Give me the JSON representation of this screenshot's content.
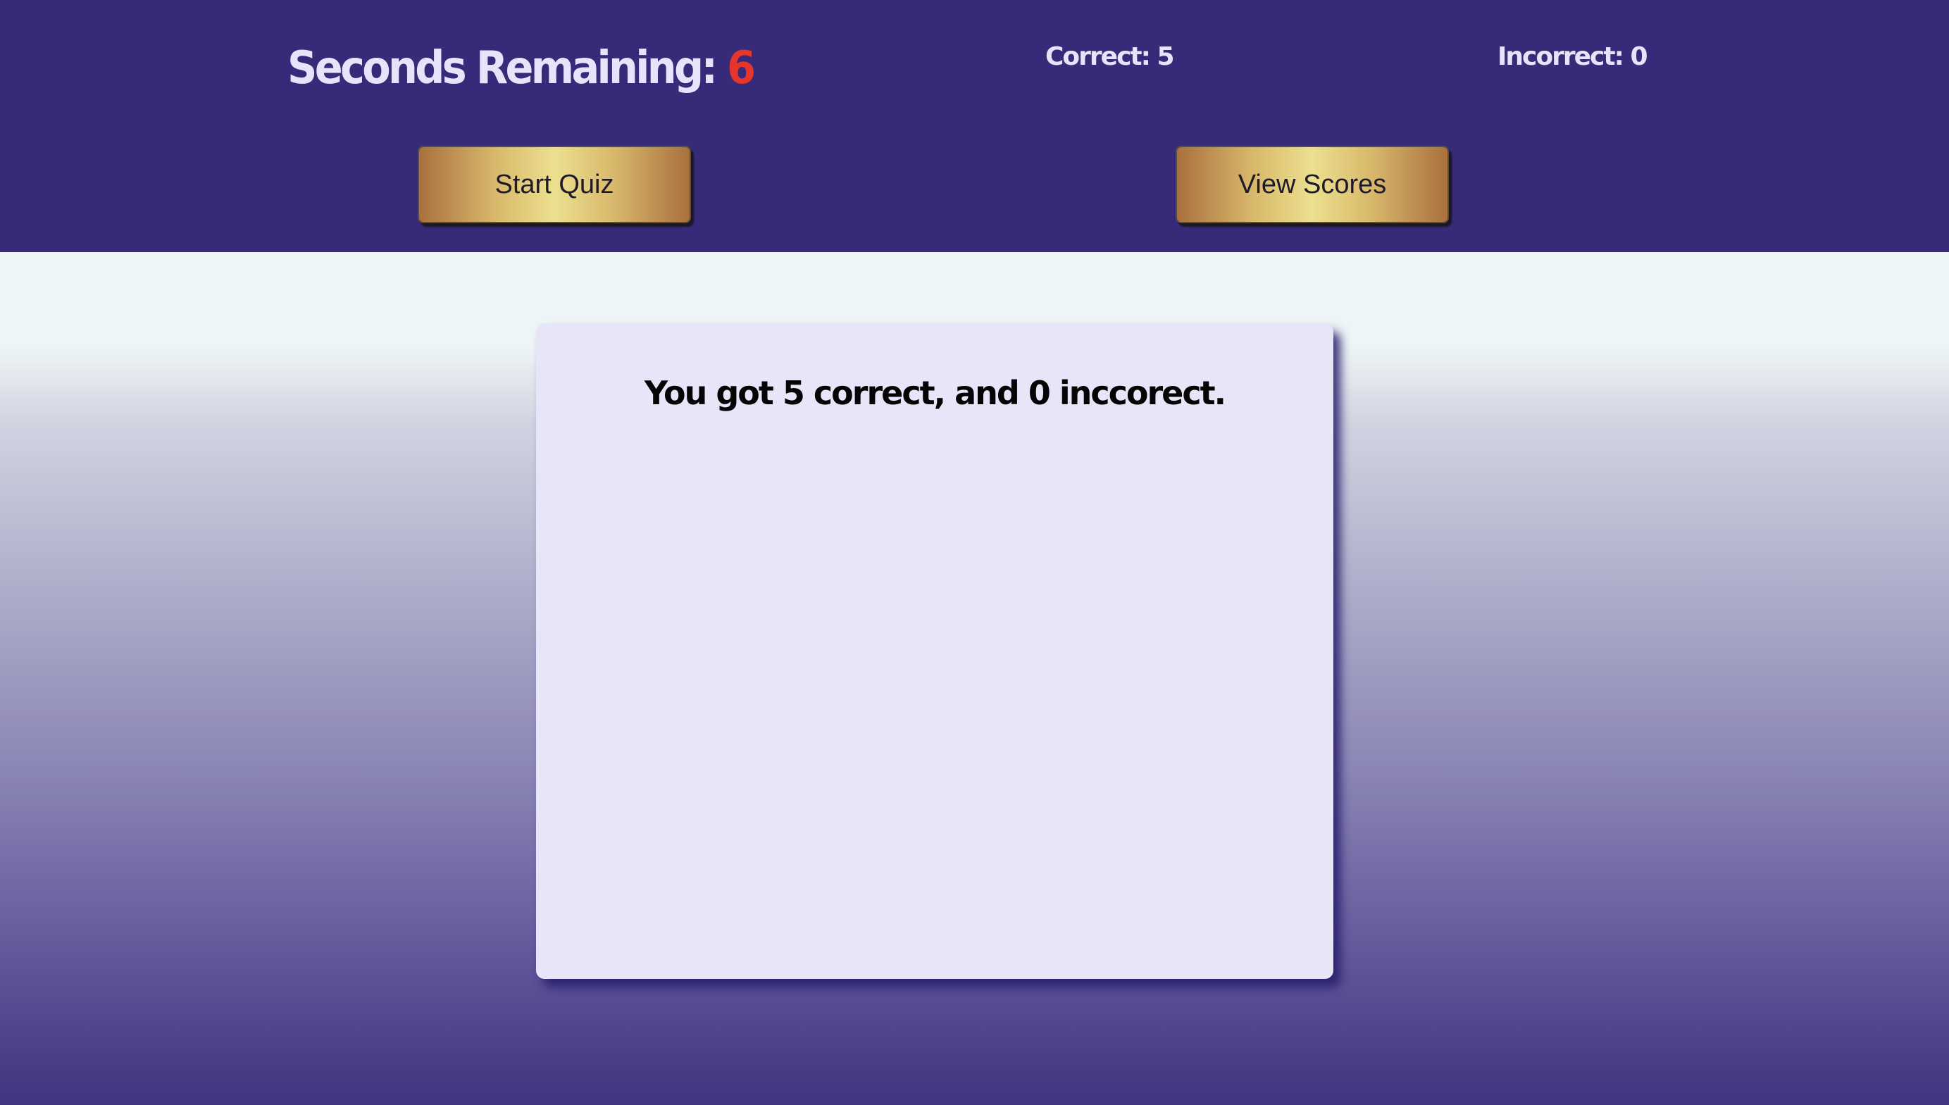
{
  "header": {
    "timer_label": "Seconds Remaining: ",
    "timer_value": "6",
    "correct_label": "Correct: 5",
    "incorrect_label": "Incorrect: 0",
    "start_button_label": "Start Quiz",
    "scores_button_label": "View Scores"
  },
  "result": {
    "message": "You got 5 correct, and 0 inccorect."
  },
  "colors": {
    "header_background": "#372b79",
    "timer_value": "#e4362a",
    "header_text": "#e6e4fa",
    "card_background": "#e7e6f8",
    "button_gold": "#ece08e",
    "button_bronze": "#a9703e"
  }
}
